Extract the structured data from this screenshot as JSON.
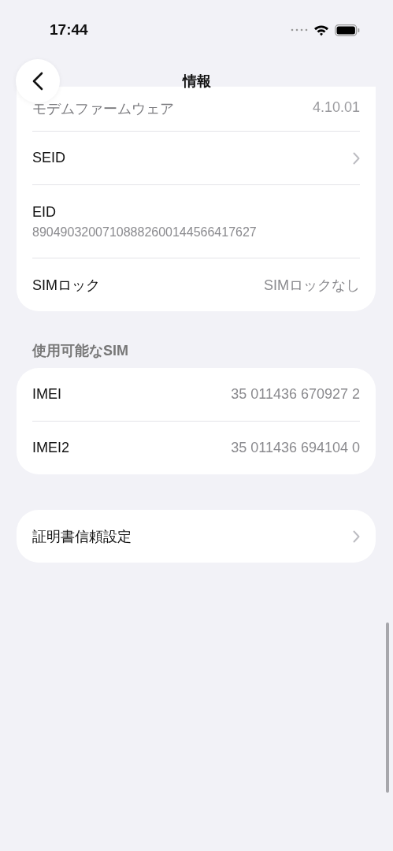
{
  "status_bar": {
    "time": "17:44"
  },
  "nav": {
    "title": "情報"
  },
  "groups": [
    {
      "rows": [
        {
          "kind": "value",
          "label": "モデムファームウェア",
          "value": "4.10.01",
          "faded": true
        },
        {
          "kind": "link",
          "label": "SEID"
        },
        {
          "kind": "stacked",
          "label": "EID",
          "value": "89049032007108882600144566417627"
        },
        {
          "kind": "value",
          "label": "SIMロック",
          "value": "SIMロックなし"
        }
      ]
    },
    {
      "header": "使用可能なSIM",
      "rows": [
        {
          "kind": "value",
          "label": "IMEI",
          "value": "35 011436 670927 2"
        },
        {
          "kind": "value",
          "label": "IMEI2",
          "value": "35 011436 694104 0"
        }
      ]
    },
    {
      "rows": [
        {
          "kind": "link",
          "label": "証明書信頼設定"
        }
      ]
    }
  ]
}
